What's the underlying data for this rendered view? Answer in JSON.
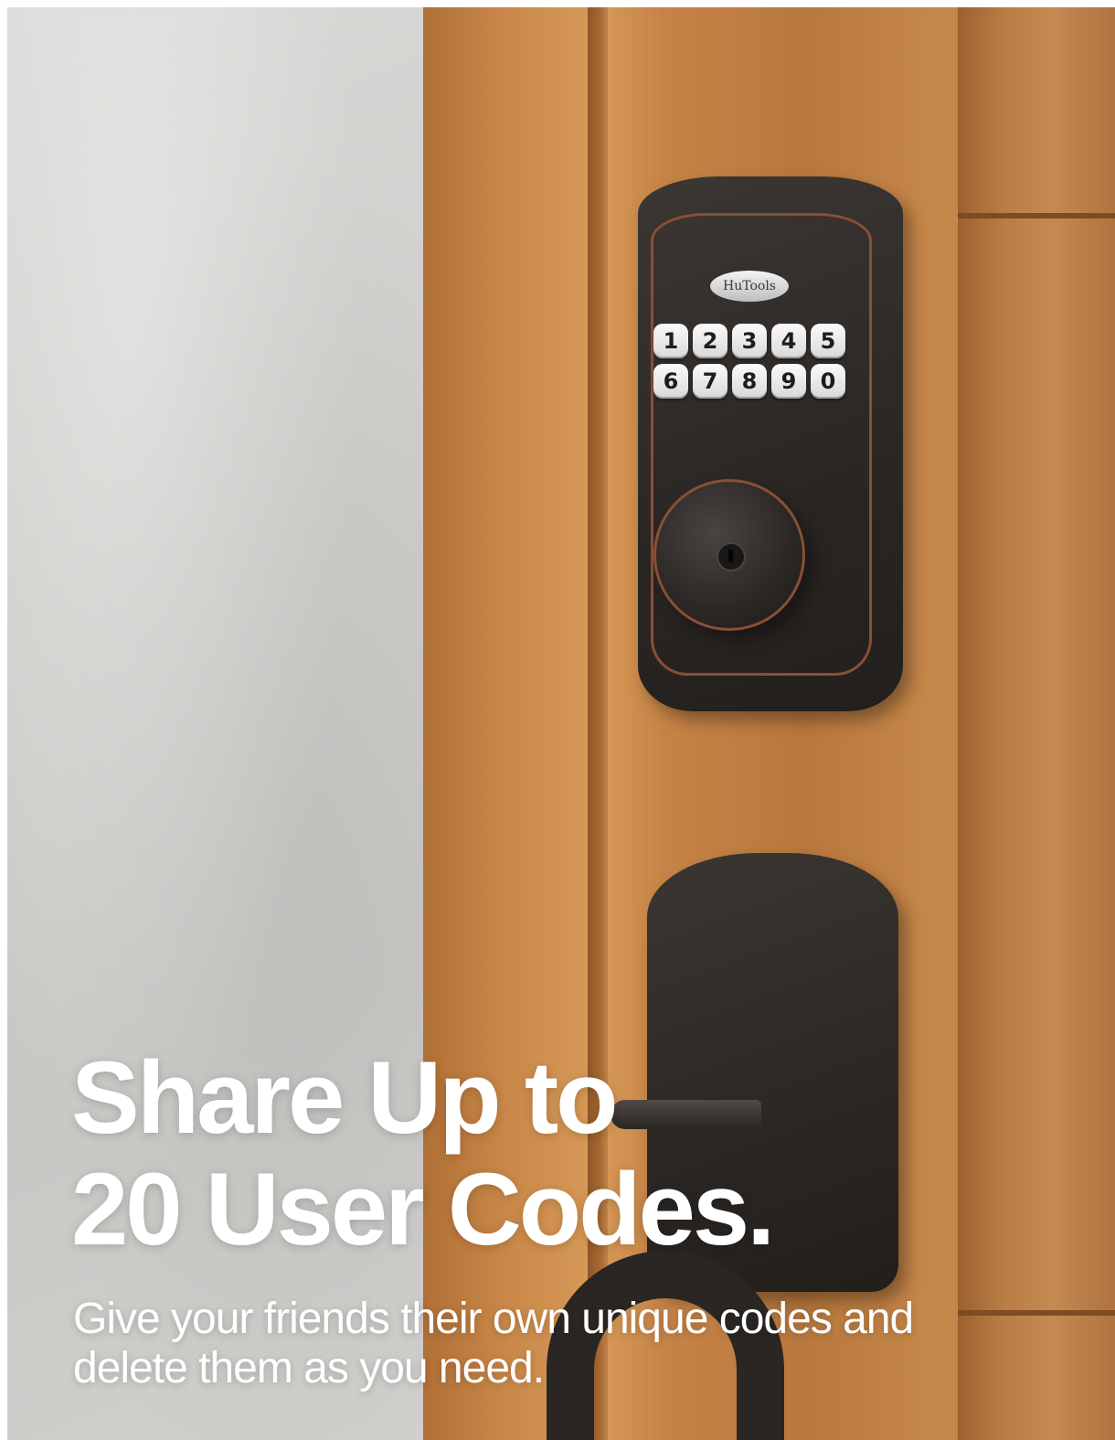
{
  "product": {
    "brand_badge": "HuTools",
    "keypad_keys": [
      "1",
      "2",
      "3",
      "4",
      "5",
      "6",
      "7",
      "8",
      "9",
      "0"
    ]
  },
  "headline": {
    "line1": "Share Up to",
    "line2": "20 User Codes."
  },
  "subheadline": {
    "line1": "Give your friends their own unique codes and",
    "line2": "delete them as you need."
  }
}
